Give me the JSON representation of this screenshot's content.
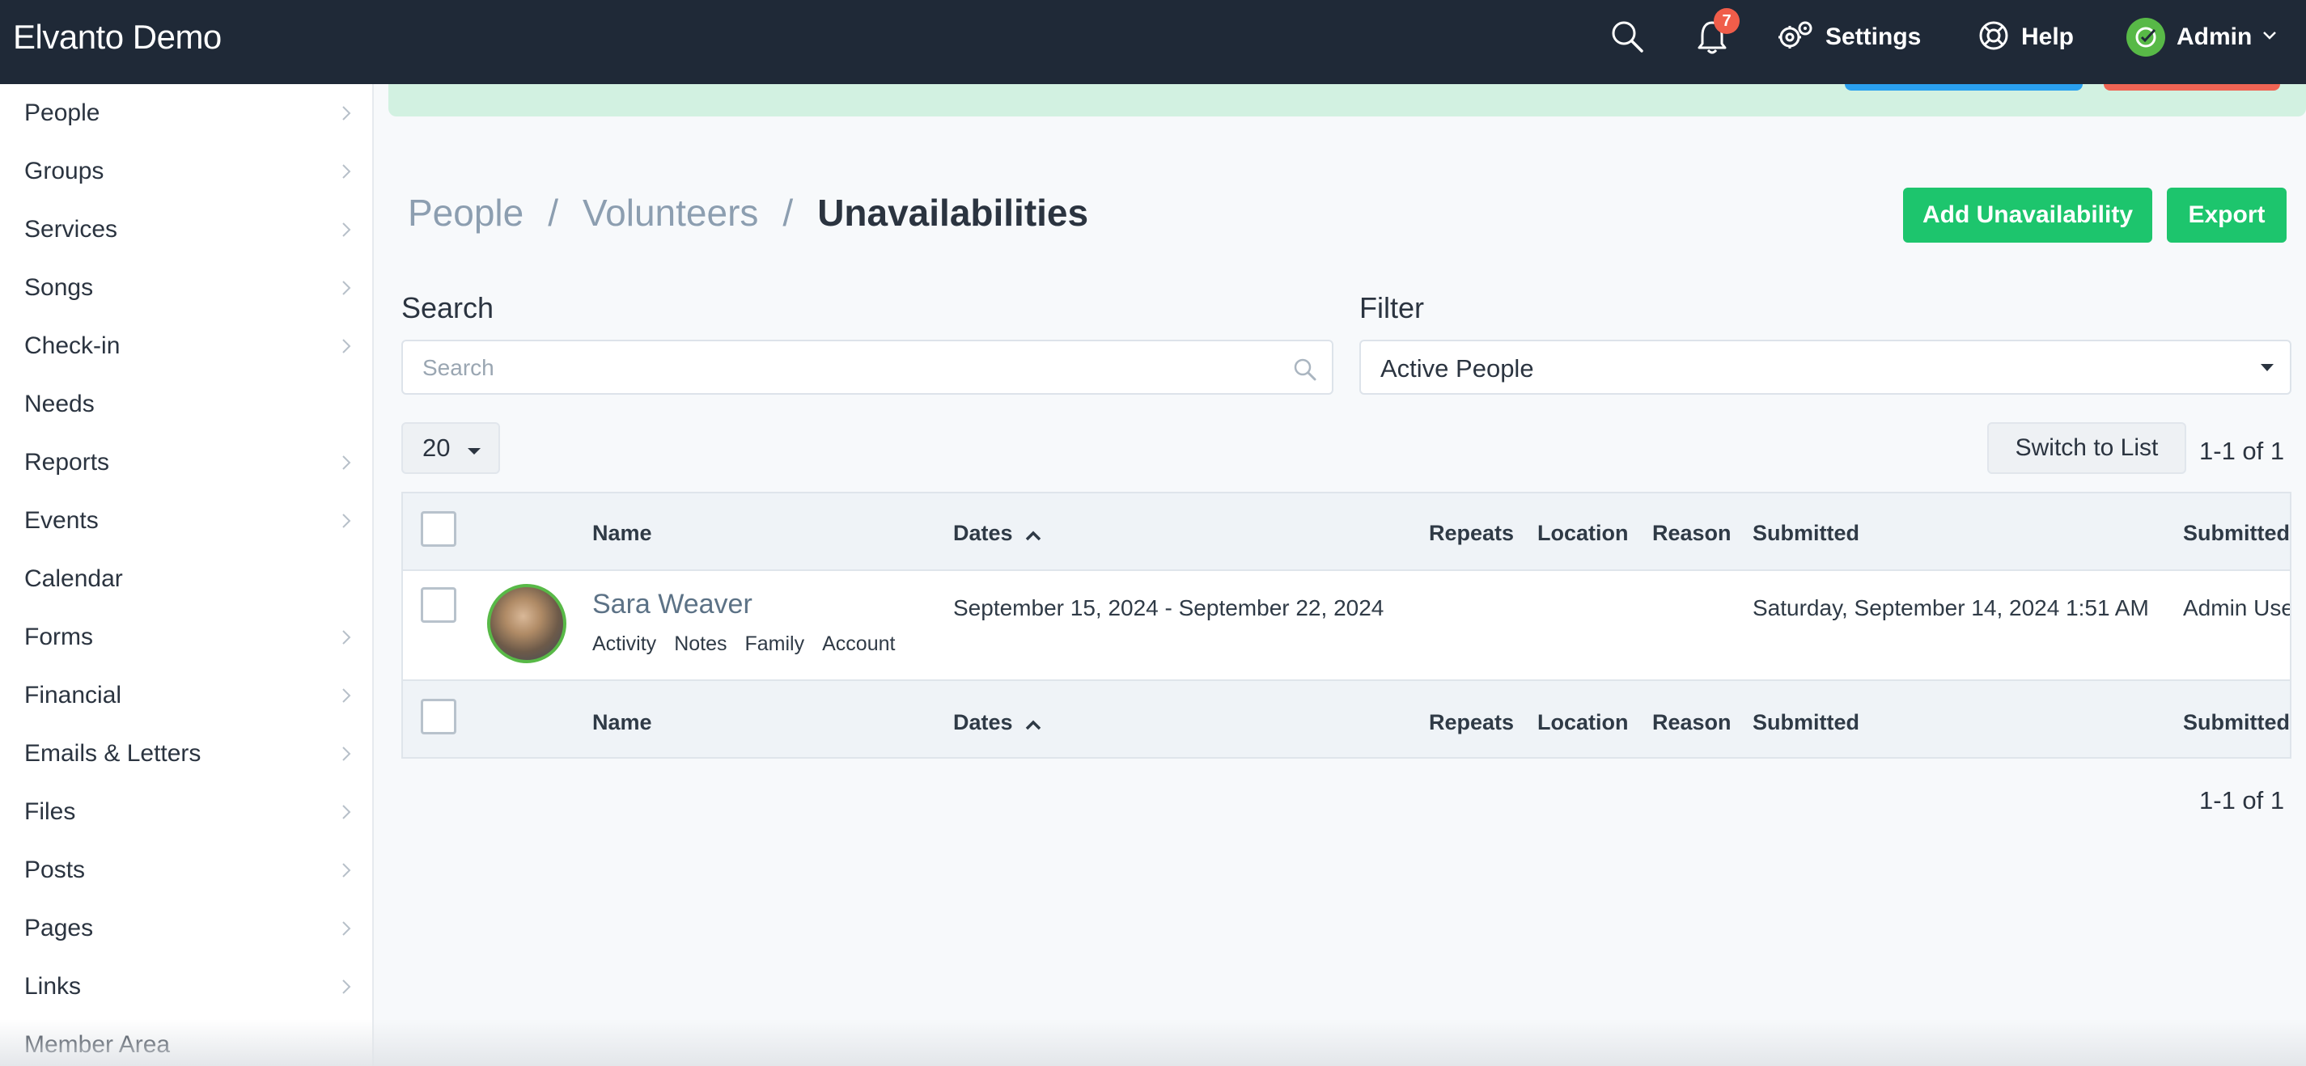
{
  "app": {
    "title": "Elvanto Demo"
  },
  "topbar": {
    "notification_count": "7",
    "settings_label": "Settings",
    "help_label": "Help",
    "admin_label": "Admin"
  },
  "sidebar": {
    "items": [
      {
        "label": "People",
        "has_chevron": true
      },
      {
        "label": "Groups",
        "has_chevron": true
      },
      {
        "label": "Services",
        "has_chevron": true
      },
      {
        "label": "Songs",
        "has_chevron": true
      },
      {
        "label": "Check-in",
        "has_chevron": true
      },
      {
        "label": "Needs",
        "has_chevron": false
      },
      {
        "label": "Reports",
        "has_chevron": true
      },
      {
        "label": "Events",
        "has_chevron": true
      },
      {
        "label": "Calendar",
        "has_chevron": false
      },
      {
        "label": "Forms",
        "has_chevron": true
      },
      {
        "label": "Financial",
        "has_chevron": true
      },
      {
        "label": "Emails & Letters",
        "has_chevron": true
      },
      {
        "label": "Files",
        "has_chevron": true
      },
      {
        "label": "Posts",
        "has_chevron": true
      },
      {
        "label": "Pages",
        "has_chevron": true
      },
      {
        "label": "Links",
        "has_chevron": true
      },
      {
        "label": "Member Area",
        "has_chevron": false
      }
    ]
  },
  "breadcrumb": {
    "items": [
      "People",
      "Volunteers"
    ],
    "separator": "/",
    "current": "Unavailabilities"
  },
  "actions": {
    "add_label": "Add Unavailability",
    "export_label": "Export"
  },
  "search": {
    "label": "Search",
    "placeholder": "Search",
    "value": ""
  },
  "filter": {
    "label": "Filter",
    "selected": "Active People"
  },
  "pagination": {
    "per_page": "20",
    "switch_label": "Switch to List",
    "range_text": "1-1 of 1"
  },
  "table": {
    "columns": {
      "name": "Name",
      "dates": "Dates",
      "repeats": "Repeats",
      "location": "Location",
      "reason": "Reason",
      "submitted": "Submitted",
      "submitted_by": "Submitted"
    },
    "rows": [
      {
        "name": "Sara Weaver",
        "links": [
          "Activity",
          "Notes",
          "Family",
          "Account"
        ],
        "dates": "September 15, 2024 - September 22, 2024",
        "repeats": "",
        "location": "",
        "reason": "",
        "submitted": "Saturday, September 14, 2024 1:51 AM",
        "submitted_by": "Admin Use"
      }
    ]
  },
  "colors": {
    "topbar": "#1f2937",
    "accent_green": "#1dc56d",
    "badge_red": "#f05d4a",
    "banner_green": "#d2f1e1"
  }
}
